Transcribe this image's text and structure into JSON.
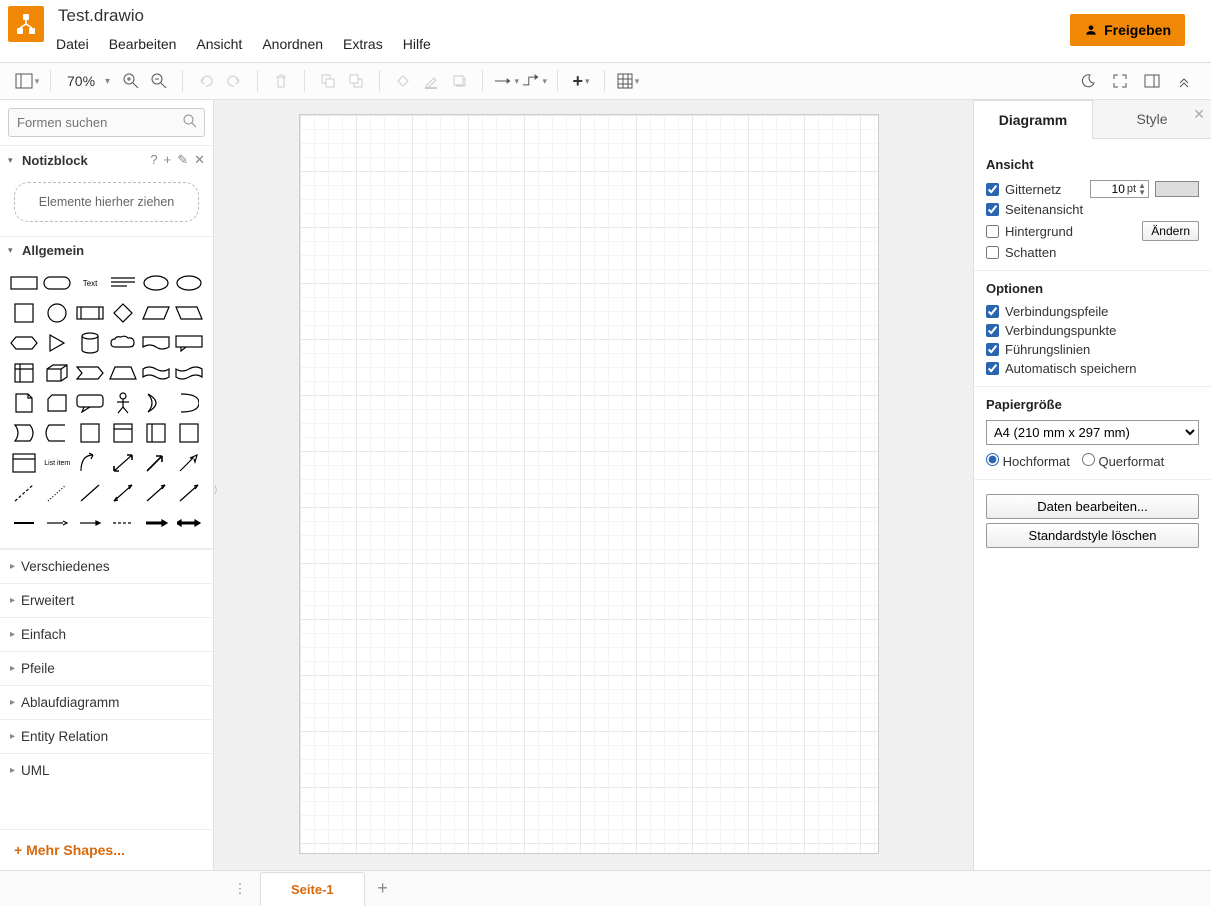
{
  "header": {
    "doc_title": "Test.drawio",
    "share_label": "Freigeben",
    "menu": [
      "Datei",
      "Bearbeiten",
      "Ansicht",
      "Anordnen",
      "Extras",
      "Hilfe"
    ]
  },
  "toolbar": {
    "zoom": "70%"
  },
  "sidebar_left": {
    "search_placeholder": "Formen suchen",
    "scratchpad": {
      "title": "Notizblock",
      "drop_hint": "Elemente hierher ziehen"
    },
    "general_title": "Allgemein",
    "collapsed_sections": [
      "Verschiedenes",
      "Erweitert",
      "Einfach",
      "Pfeile",
      "Ablaufdiagramm",
      "Entity Relation",
      "UML"
    ],
    "more_shapes": "Mehr Shapes..."
  },
  "sidebar_right": {
    "tabs": {
      "diagram": "Diagramm",
      "style": "Style"
    },
    "view": {
      "title": "Ansicht",
      "grid": "Gitternetz",
      "grid_size": "10",
      "grid_unit": "pt",
      "page_view": "Seitenansicht",
      "background": "Hintergrund",
      "background_btn": "Ändern",
      "shadow": "Schatten"
    },
    "options": {
      "title": "Optionen",
      "arrows": "Verbindungspfeile",
      "points": "Verbindungspunkte",
      "guides": "Führungslinien",
      "autosave": "Automatisch speichern"
    },
    "paper": {
      "title": "Papiergröße",
      "selected": "A4 (210 mm x 297 mm)",
      "portrait": "Hochformat",
      "landscape": "Querformat"
    },
    "edit_data_btn": "Daten bearbeiten...",
    "clear_style_btn": "Standardstyle löschen"
  },
  "footer": {
    "page_tab": "Seite-1"
  }
}
